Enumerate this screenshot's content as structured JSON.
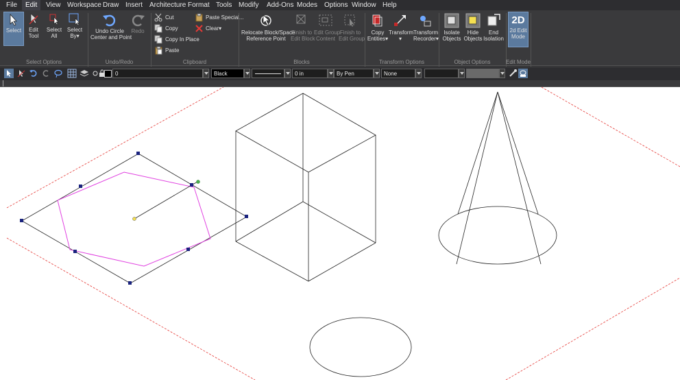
{
  "menu": [
    {
      "label": "File",
      "active": false
    },
    {
      "label": "Edit",
      "active": true
    },
    {
      "label": "View",
      "active": false
    },
    {
      "label": "Workspace",
      "active": false
    },
    {
      "label": "Draw",
      "active": false
    },
    {
      "label": "Insert",
      "active": false
    },
    {
      "label": "Architecture",
      "active": false
    },
    {
      "label": "Format",
      "active": false
    },
    {
      "label": "Tools",
      "active": false
    },
    {
      "label": "Modify",
      "active": false
    },
    {
      "label": "Add-Ons",
      "active": false
    },
    {
      "label": "Modes",
      "active": false
    },
    {
      "label": "Options",
      "active": false
    },
    {
      "label": "Window",
      "active": false
    },
    {
      "label": "Help",
      "active": false
    }
  ],
  "ribbon": {
    "select_options": {
      "label": "Select Options",
      "select": "Select",
      "edit_tool": [
        "Edit",
        "Tool"
      ],
      "select_all": [
        "Select",
        "All"
      ],
      "select_by": [
        "Select",
        "By"
      ]
    },
    "undo_redo": {
      "label": "Undo/Redo",
      "undo": [
        "Undo Circle",
        "Center and Point"
      ],
      "redo": "Redo"
    },
    "clipboard": {
      "label": "Clipboard",
      "cut": "Cut",
      "copy": "Copy",
      "copy_in_place": "Copy In Place",
      "paste": "Paste",
      "paste_special": "Paste Special...",
      "clear": "Clear"
    },
    "blocks": {
      "label": "Blocks",
      "relocate": [
        "Relocate Block/Space",
        "Reference Point"
      ],
      "finish_block": [
        "Finish to",
        "Edit Block"
      ],
      "edit_group": [
        "Edit Group",
        "Content"
      ],
      "finish_group": [
        "Finish to",
        "Edit Group"
      ]
    },
    "transform_options": {
      "label": "Transform Options",
      "copy_entities": [
        "Copy",
        "Entities"
      ],
      "transform": "Transform",
      "transform_recorder": [
        "Transform",
        "Recorder"
      ]
    },
    "object_options": {
      "label": "Object Options",
      "isolate": [
        "Isolate",
        "Objects"
      ],
      "hide": [
        "Hide",
        "Objects"
      ],
      "end_isolation": [
        "End",
        "Isolation"
      ]
    },
    "edit_mode": {
      "label": "Edit Mode",
      "mode_icon": "2D",
      "mode": [
        "2d Edit",
        "Mode"
      ]
    }
  },
  "toolbar": {
    "layer_value": "0",
    "color_value": "Black",
    "thickness_value": "0 in",
    "pen_value": "By Pen",
    "fill_value": "None"
  },
  "colors": {
    "selection_pink": "#e040e0",
    "grip_blue": "#1a237e",
    "grid_red": "#e53935",
    "accent": "#5b7a9e"
  }
}
